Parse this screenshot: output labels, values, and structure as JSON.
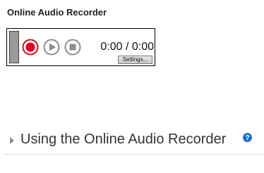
{
  "section": {
    "title": "Online Audio Recorder"
  },
  "recorder": {
    "time_readout": "0:00 / 0:00",
    "settings_label": "Settings...",
    "controls": {
      "record_icon": "record-icon",
      "play_icon": "play-icon",
      "stop_icon": "stop-icon"
    },
    "colors": {
      "record": "#e0001b",
      "control_gray": "#8c8c8c",
      "meter": "#9a9a9a"
    }
  },
  "help": {
    "link_text": "Using the Online Audio Recorder",
    "icon": "question-circle-icon",
    "icon_color": "#1f6fd6"
  }
}
